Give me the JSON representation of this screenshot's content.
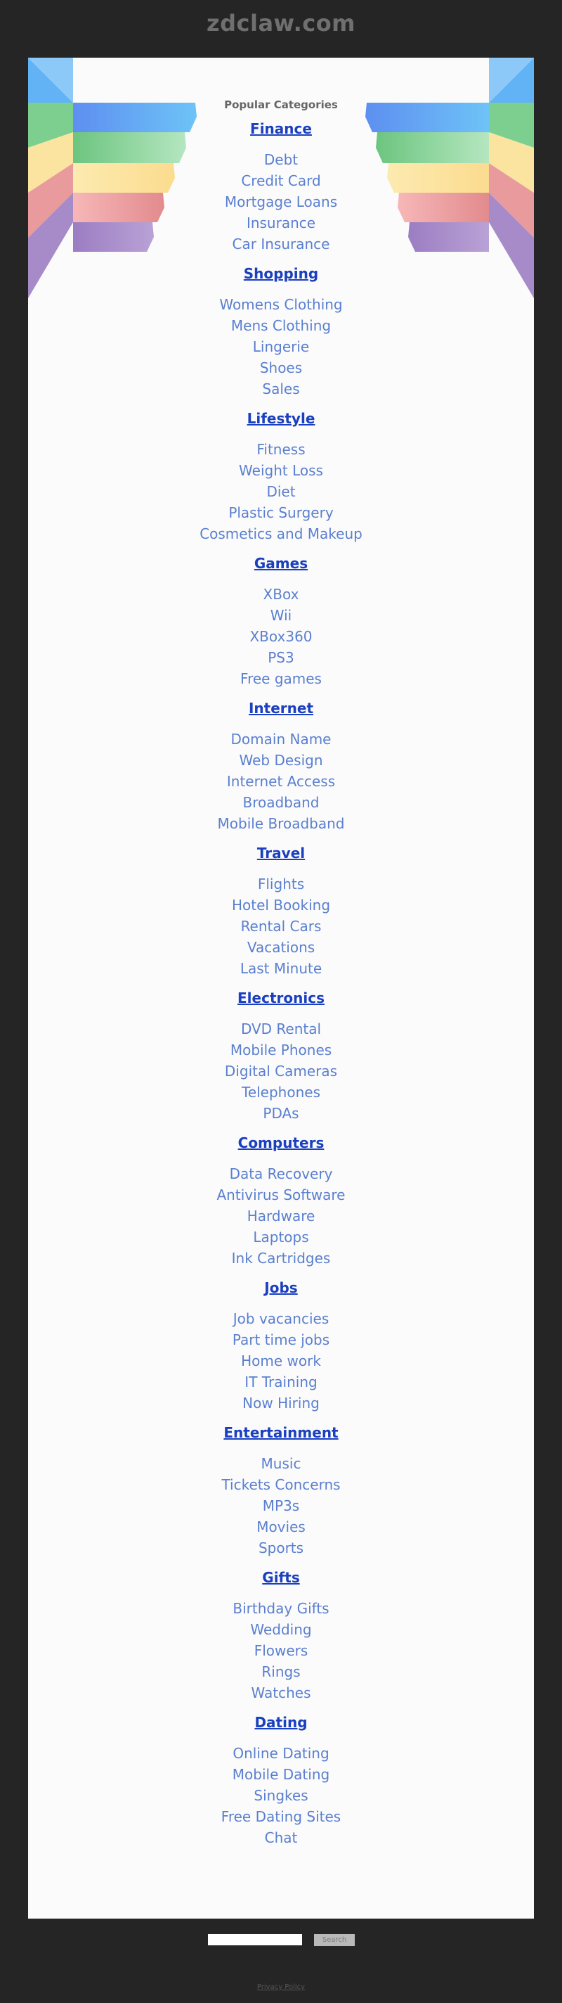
{
  "site": {
    "title": "zdclaw.com"
  },
  "main": {
    "heading": "Popular Categories",
    "categories": [
      {
        "name": "Finance",
        "items": [
          "Debt",
          "Credit Card",
          "Mortgage Loans",
          "Insurance",
          "Car Insurance"
        ]
      },
      {
        "name": "Shopping",
        "items": [
          "Womens Clothing",
          "Mens Clothing",
          "Lingerie",
          "Shoes",
          "Sales"
        ]
      },
      {
        "name": "Lifestyle",
        "items": [
          "Fitness",
          "Weight Loss",
          "Diet",
          "Plastic Surgery",
          "Cosmetics and Makeup"
        ]
      },
      {
        "name": "Games",
        "items": [
          "XBox",
          "Wii",
          "XBox360",
          "PS3",
          "Free games"
        ]
      },
      {
        "name": "Internet",
        "items": [
          "Domain Name",
          "Web Design",
          "Internet Access",
          "Broadband",
          "Mobile Broadband"
        ]
      },
      {
        "name": "Travel",
        "items": [
          "Flights",
          "Hotel Booking",
          "Rental Cars",
          "Vacations",
          "Last Minute"
        ]
      },
      {
        "name": "Electronics",
        "items": [
          "DVD Rental",
          "Mobile Phones",
          "Digital Cameras",
          "Telephones",
          "PDAs"
        ]
      },
      {
        "name": "Computers",
        "items": [
          "Data Recovery",
          "Antivirus Software",
          "Hardware",
          "Laptops",
          "Ink Cartridges"
        ]
      },
      {
        "name": "Jobs",
        "items": [
          "Job vacancies",
          "Part time jobs",
          "Home work",
          "IT Training",
          "Now Hiring"
        ]
      },
      {
        "name": "Entertainment",
        "items": [
          "Music",
          "Tickets Concerns",
          "MP3s",
          "Movies",
          "Sports"
        ]
      },
      {
        "name": "Gifts",
        "items": [
          "Birthday Gifts",
          "Wedding",
          "Flowers",
          "Rings",
          "Watches"
        ]
      },
      {
        "name": "Dating",
        "items": [
          "Online Dating",
          "Mobile Dating",
          "Singkes",
          "Free Dating Sites",
          "Chat"
        ]
      }
    ]
  },
  "search": {
    "placeholder": "",
    "value": "",
    "button_label": "Search"
  },
  "footer": {
    "privacy_label": "Privacy Policy"
  },
  "colors": {
    "background": "#252525",
    "panel": "#fbfbfb",
    "category_link": "#1a3fbf",
    "sub_link": "#5a7fd0",
    "ribbons": [
      "#5aa8f4",
      "#7ccf8e",
      "#fbe4a0",
      "#e99a9c",
      "#a68bc8"
    ]
  }
}
